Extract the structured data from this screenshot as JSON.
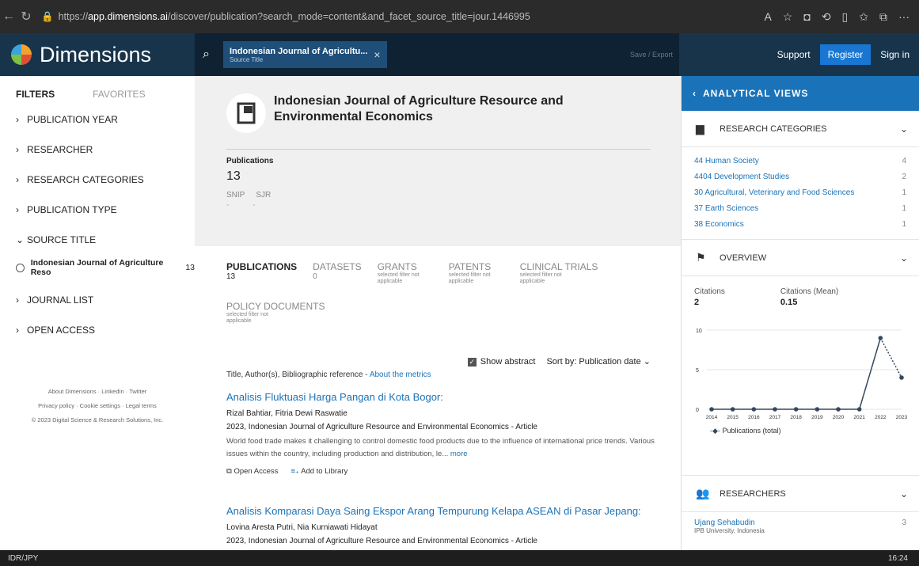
{
  "browser": {
    "url_prefix": "https://",
    "url_host": "app.dimensions.ai",
    "url_path": "/discover/publication?search_mode=content&and_facet_source_title=jour.1446995"
  },
  "header": {
    "logo": "Dimensions",
    "chip_title": "Indonesian Journal of Agricultu...",
    "chip_sub": "Source Title",
    "save_export": "Save / Export",
    "support": "Support",
    "register": "Register",
    "signin": "Sign in"
  },
  "filters": {
    "tab_filters": "FILTERS",
    "tab_favorites": "FAVORITES",
    "items": [
      "PUBLICATION YEAR",
      "RESEARCHER",
      "RESEARCH CATEGORIES",
      "PUBLICATION TYPE",
      "SOURCE TITLE"
    ],
    "source_item": "Indonesian Journal of Agriculture Reso",
    "source_count": "13",
    "items2": [
      "JOURNAL LIST",
      "OPEN ACCESS"
    ],
    "footer1": "About Dimensions · LinkedIn · Twitter",
    "footer2": "Privacy policy · Cookie settings · Legal terms",
    "footer3": "© 2023 Digital Science & Research Solutions, Inc."
  },
  "source": {
    "title": "Indonesian Journal of Agriculture Resource and Environmental Economics",
    "pubs_label": "Publications",
    "pubs_count": "13",
    "snip": "SNIP",
    "sjr": "SJR",
    "dash1": "-",
    "dash2": "-"
  },
  "tabs": [
    {
      "label": "PUBLICATIONS",
      "count": "13",
      "note": ""
    },
    {
      "label": "DATASETS",
      "count": "0",
      "note": ""
    },
    {
      "label": "GRANTS",
      "count": "",
      "note": "selected filter not applicable"
    },
    {
      "label": "PATENTS",
      "count": "",
      "note": "selected filter not applicable"
    },
    {
      "label": "CLINICAL TRIALS",
      "count": "",
      "note": "selected filter not applicable"
    }
  ],
  "tab_policy": {
    "label": "POLICY DOCUMENTS",
    "note": "selected filter not applicable"
  },
  "controls": {
    "show_abstract": "Show abstract",
    "sort": "Sort by: Publication date",
    "tai": "Title, Author(s), Bibliographic reference - ",
    "metrics_link": "About the metrics"
  },
  "results": [
    {
      "title": "Analisis Fluktuasi Harga Pangan di Kota Bogor:",
      "authors": "Rizal Bahtiar, Fitria Dewi Raswatie",
      "ref": "2023, Indonesian Journal of Agriculture Resource and Environmental Economics - Article",
      "abstract": "World food trade makes it challenging to control domestic food products due to the influence of international price trends. Various issues within the country, including production and distribution, le...",
      "more": "more",
      "oa": "Open Access",
      "lib": "Add to Library"
    },
    {
      "title": "Analisis Komparasi Daya Saing Ekspor Arang Tempurung Kelapa ASEAN di Pasar Jepang:",
      "authors": "Lovina Aresta Putri, Nia Kurniawati Hidayat",
      "ref": "2023, Indonesian Journal of Agriculture Resource and Environmental Economics - Article"
    }
  ],
  "right": {
    "title": "ANALYTICAL VIEWS",
    "research_categories": "RESEARCH CATEGORIES",
    "categories": [
      {
        "name": "44 Human Society",
        "count": "4"
      },
      {
        "name": "4404 Development Studies",
        "count": "2"
      },
      {
        "name": "30 Agricultural, Veterinary and Food Sciences",
        "count": "1"
      },
      {
        "name": "37 Earth Sciences",
        "count": "1"
      },
      {
        "name": "38 Economics",
        "count": "1"
      }
    ],
    "overview": "OVERVIEW",
    "citations_label": "Citations",
    "citations": "2",
    "citations_mean_label": "Citations (Mean)",
    "citations_mean": "0.15",
    "legend": "Publications (total)",
    "researchers": "RESEARCHERS",
    "researcher_name": "Ujang Sehabudin",
    "researcher_aff": "IPB University, Indonesia",
    "researcher_count": "3"
  },
  "chart_data": {
    "type": "line",
    "x": [
      "2014",
      "2015",
      "2016",
      "2017",
      "2018",
      "2019",
      "2020",
      "2021",
      "2022",
      "2023"
    ],
    "series": [
      {
        "name": "Publications (total)",
        "values": [
          0,
          0,
          0,
          0,
          0,
          0,
          0,
          0,
          9,
          4
        ]
      }
    ],
    "yticks": [
      "10",
      "5",
      "0"
    ],
    "ylim": [
      0,
      10
    ],
    "colors": {
      "line": "#34495e"
    }
  },
  "taskbar": {
    "left": "IDR/JPY",
    "time": "16:24"
  }
}
